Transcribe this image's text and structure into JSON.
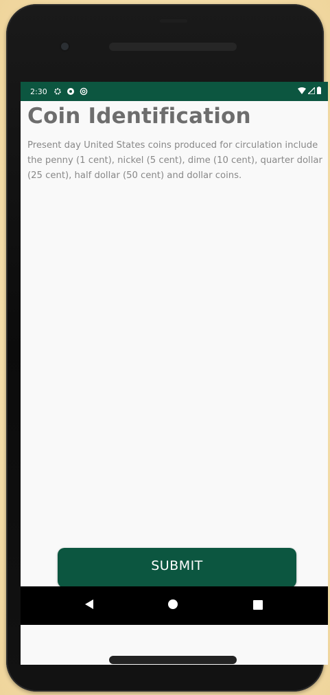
{
  "status_bar": {
    "time": "2:30",
    "icons": [
      "gear-icon",
      "shield-icon",
      "at-icon"
    ],
    "right_icons": [
      "wifi-icon",
      "cell-signal-icon",
      "battery-icon"
    ]
  },
  "page": {
    "title": "Coin Identification",
    "description": " Present day United States coins produced for circulation include the penny (1 cent), nickel (5 cent), dime (10 cent), quarter dollar (25 cent), half dollar (50 cent) and dollar coins."
  },
  "actions": {
    "submit_label": "SUBMIT"
  },
  "nav_bar": {
    "buttons": [
      "back",
      "home",
      "recents"
    ]
  },
  "colors": {
    "brand": "#0c5640",
    "title_text": "#6d6d6d",
    "body_text": "#888888",
    "screen_bg": "#f9f9f9",
    "backdrop": "#f6e4b8"
  }
}
